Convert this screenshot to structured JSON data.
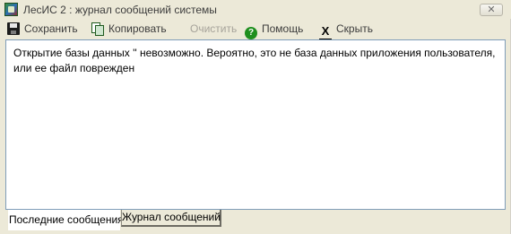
{
  "window": {
    "title": "ЛесИС 2 :  журнал сообщений системы",
    "close_label": "✕"
  },
  "toolbar": {
    "save_label": "Сохранить",
    "copy_label": "Копировать",
    "clear_label": "Очистить",
    "help_label": "Помощь",
    "hide_label": "Скрыть",
    "help_icon_glyph": "?",
    "hide_icon_glyph": "X"
  },
  "icons": {
    "app": "app-logo-icon",
    "save": "floppy-disk-icon",
    "copy": "copy-icon",
    "help": "help-icon",
    "hide": "hide-icon"
  },
  "messages": {
    "text": "Открытие базы данных '' невозможно.  Вероятно, это не база данных приложения пользователя, или ее файл поврежден"
  },
  "tabs": [
    {
      "label": "Последние сообщения",
      "active": true
    },
    {
      "label": "Журнал сообщений",
      "active": false
    }
  ]
}
